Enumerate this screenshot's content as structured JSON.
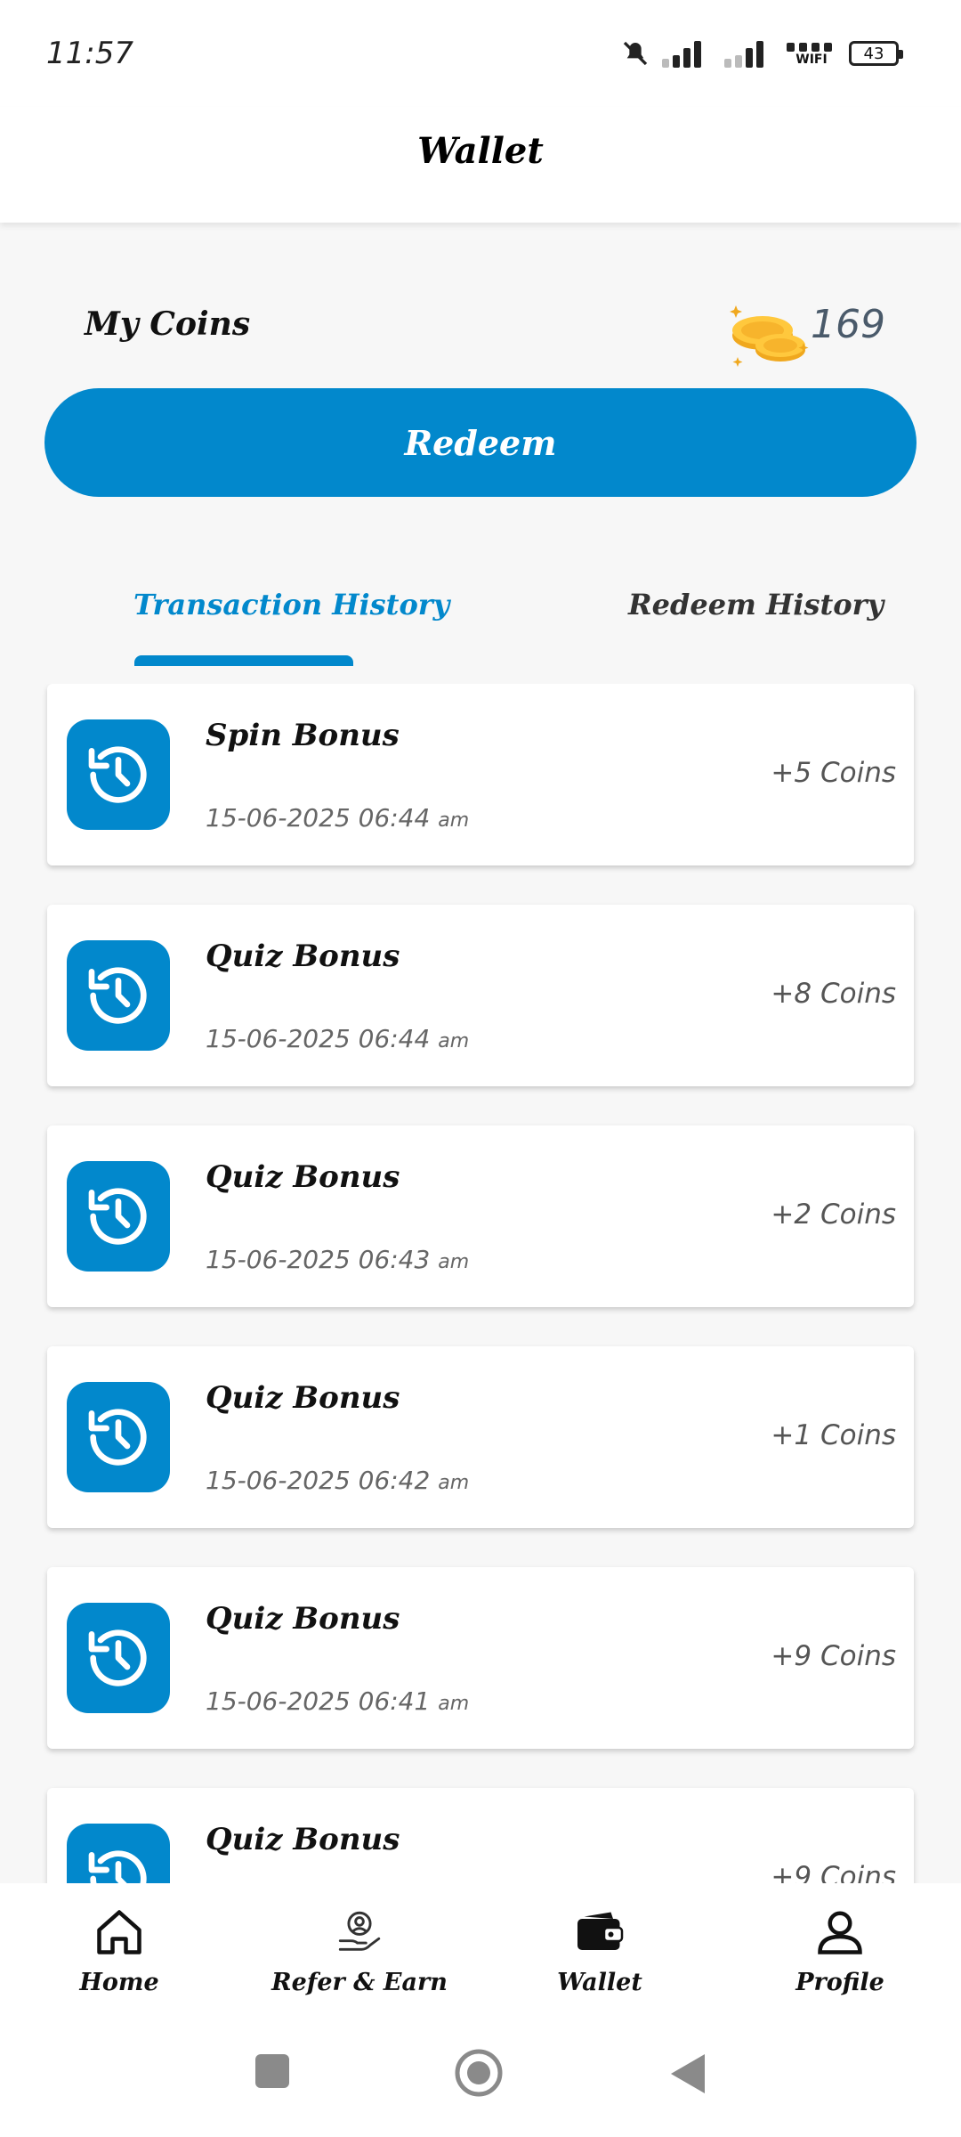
{
  "status_bar": {
    "time": "11:57",
    "battery": "43",
    "wifi_label": "WIFI"
  },
  "header": {
    "title": "Wallet"
  },
  "coins": {
    "label": "My Coins",
    "value": "169"
  },
  "redeem_button": {
    "label": "Redeem"
  },
  "tabs": [
    {
      "label": "Transaction History",
      "active": true
    },
    {
      "label": "Redeem History",
      "active": false
    }
  ],
  "transactions": [
    {
      "title": "Spin Bonus",
      "date": "15-06-2025 06:44",
      "ampm": "am",
      "amount": "+5 Coins"
    },
    {
      "title": "Quiz Bonus",
      "date": "15-06-2025 06:44",
      "ampm": "am",
      "amount": "+8 Coins"
    },
    {
      "title": "Quiz Bonus",
      "date": "15-06-2025 06:43",
      "ampm": "am",
      "amount": "+2 Coins"
    },
    {
      "title": "Quiz Bonus",
      "date": "15-06-2025 06:42",
      "ampm": "am",
      "amount": "+1 Coins"
    },
    {
      "title": "Quiz Bonus",
      "date": "15-06-2025 06:41",
      "ampm": "am",
      "amount": "+9 Coins"
    },
    {
      "title": "Quiz Bonus",
      "date": "",
      "ampm": "",
      "amount": "+9 Coins"
    }
  ],
  "bottom_nav": [
    {
      "label": "Home",
      "icon": "home-icon",
      "active": false
    },
    {
      "label": "Refer & Earn",
      "icon": "refer-earn-icon",
      "active": false
    },
    {
      "label": "Wallet",
      "icon": "wallet-icon",
      "active": true
    },
    {
      "label": "Profile",
      "icon": "profile-icon",
      "active": false
    }
  ],
  "colors": {
    "accent": "#0288cc",
    "background": "#f7f7f7",
    "card": "#ffffff",
    "muted_text": "#666666"
  }
}
